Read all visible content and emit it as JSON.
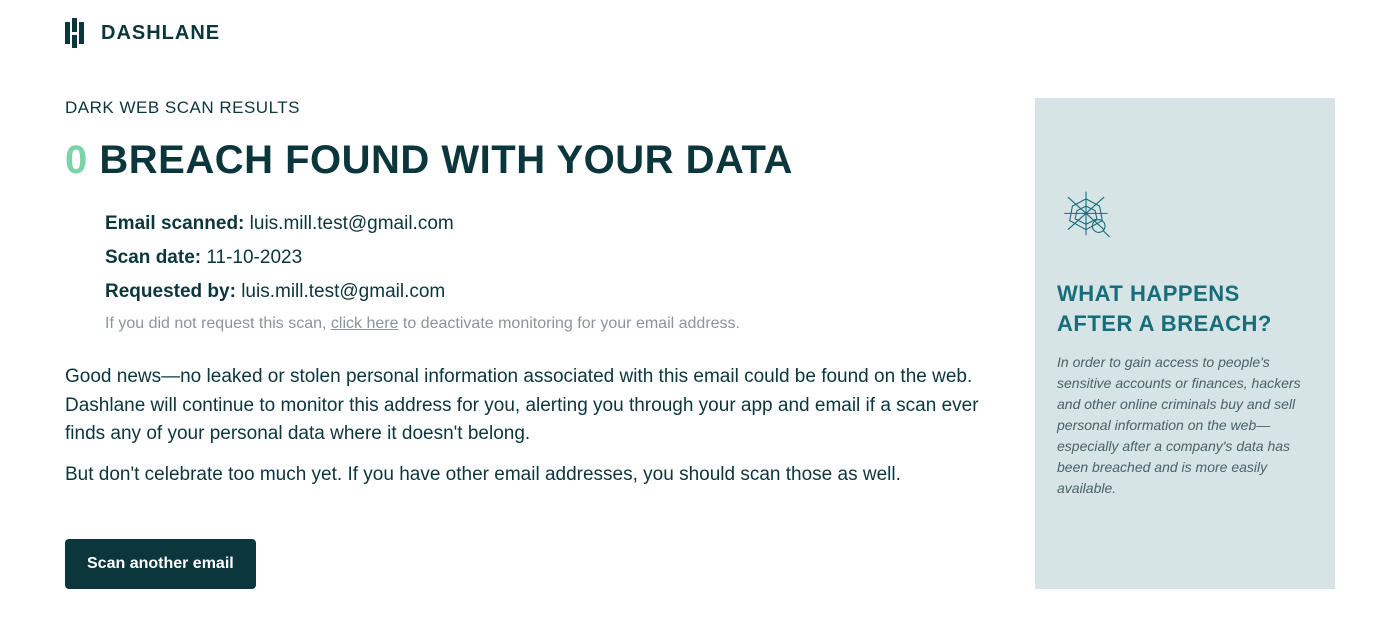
{
  "brand": {
    "name": "DASHLANE"
  },
  "kicker": "DARK WEB SCAN RESULTS",
  "headline": {
    "count": "0",
    "rest": " BREACH FOUND WITH YOUR DATA"
  },
  "meta": {
    "email_label": "Email scanned:",
    "email_value": " luis.mill.test@gmail.com",
    "date_label": "Scan date:",
    "date_value": " 11-10-2023",
    "requester_label": "Requested by:",
    "requester_value": " luis.mill.test@gmail.com"
  },
  "opt_out": {
    "prefix": "If you did not request this scan, ",
    "link": "click here",
    "suffix": " to deactivate monitoring for your email address."
  },
  "body": {
    "p1": "Good news—no leaked or stolen personal information associated with this email could be found on the web. Dashlane will continue to monitor this address for you, alerting you through your app and email if a scan ever finds any of your personal data where it doesn't belong.",
    "p2": "But don't celebrate too much yet. If you have other email addresses, you should scan those as well."
  },
  "cta": {
    "scan_another": "Scan another email"
  },
  "sidebar": {
    "title": "WHAT HAPPENS AFTER A BREACH?",
    "body": "In order to gain access to people's sensitive accounts or finances, hackers and other online criminals buy and sell personal information on the web—especially after a company's data has been breached and is more easily available."
  }
}
